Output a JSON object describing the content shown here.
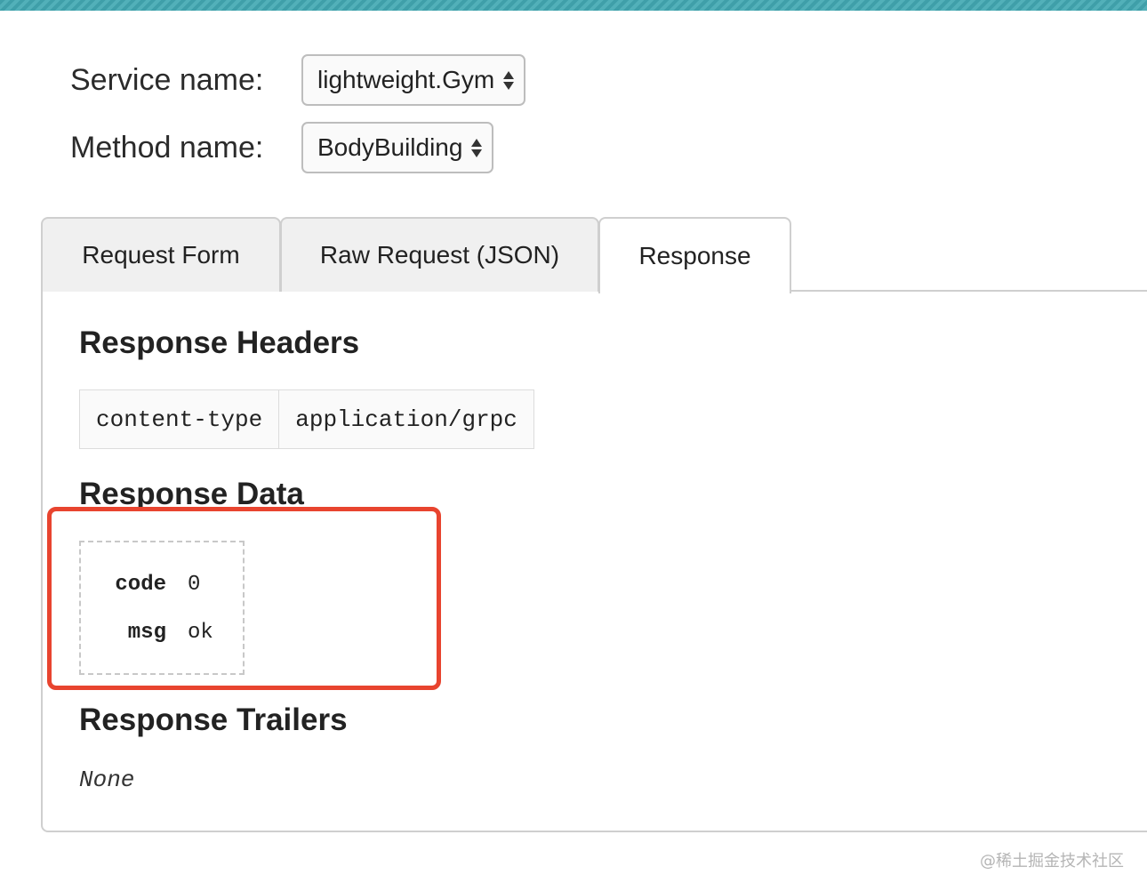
{
  "form": {
    "service_label": "Service name:",
    "service_value": "lightweight.Gym",
    "method_label": "Method name:",
    "method_value": "BodyBuilding"
  },
  "tabs": [
    {
      "label": "Request Form",
      "active": false
    },
    {
      "label": "Raw Request (JSON)",
      "active": false
    },
    {
      "label": "Response",
      "active": true
    }
  ],
  "response": {
    "headers_title": "Response Headers",
    "headers": [
      {
        "key": "content-type",
        "value": "application/grpc"
      }
    ],
    "data_title": "Response Data",
    "data": [
      {
        "key": "code",
        "value": "0"
      },
      {
        "key": "msg",
        "value": "ok"
      }
    ],
    "trailers_title": "Response Trailers",
    "trailers_value": "None"
  },
  "annotation": {
    "highlight_color": "#e8442f"
  },
  "watermark": "@稀土掘金技术社区",
  "icons": [
    "sort-icon"
  ]
}
